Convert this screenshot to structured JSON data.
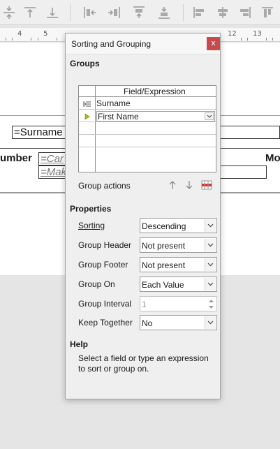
{
  "ruler": {
    "numbers": [
      "4",
      "5",
      "12",
      "13"
    ]
  },
  "background": {
    "surname_field": "=Surname",
    "heading_left": "umber",
    "heading_right": "Mo",
    "field_1": "=Car",
    "field_2": "=Mak"
  },
  "dialog": {
    "title": "Sorting and Grouping",
    "close_label": "x",
    "groups": {
      "heading": "Groups",
      "column_header": "Field/Expression",
      "rows": [
        {
          "value": "Surname"
        },
        {
          "value": "First Name"
        }
      ],
      "actions_label": "Group actions"
    },
    "properties": {
      "heading": "Properties",
      "sorting": {
        "label": "Sorting",
        "value": "Descending"
      },
      "group_header": {
        "label": "Group Header",
        "value": "Not present"
      },
      "group_footer": {
        "label": "Group Footer",
        "value": "Not present"
      },
      "group_on": {
        "label": "Group On",
        "value": "Each Value"
      },
      "group_interval": {
        "label": "Group Interval",
        "value": "1"
      },
      "keep_together": {
        "label": "Keep Together",
        "value": "No"
      }
    },
    "help": {
      "heading": "Help",
      "text": "Select a field or type an expression to sort or group on."
    }
  },
  "colors": {
    "close_button": "#c94a4a",
    "selected_marker": "#9bc21a"
  }
}
